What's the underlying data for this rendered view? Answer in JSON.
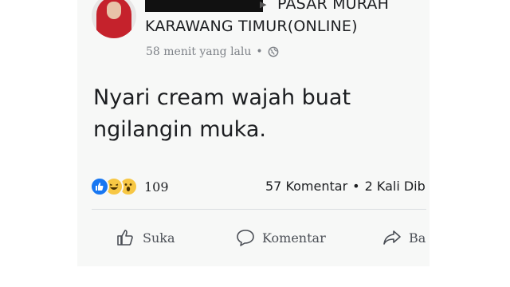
{
  "post": {
    "group_name_line1": "PASAR MURAH",
    "group_name_line2": "KARAWANG TIMUR(ONLINE)",
    "timestamp": "58 menit yang lalu",
    "separator": "•",
    "text_line1": "Nyari cream wajah buat",
    "text_line2": "ngilangin muka.",
    "audience_icon": "globe-icon"
  },
  "reactions": {
    "icons": [
      "like-icon",
      "haha-icon",
      "wow-icon"
    ],
    "count": "109"
  },
  "stats": {
    "comments": "57 Komentar",
    "separator": "•",
    "shares": "2 Kali Dib"
  },
  "actions": {
    "like": "Suka",
    "comment": "Komentar",
    "share": "Ba"
  },
  "colors": {
    "like_blue": "#1877f2",
    "reaction_yellow": "#f7c744",
    "text": "#1c1e21",
    "meta": "#7e8288"
  }
}
